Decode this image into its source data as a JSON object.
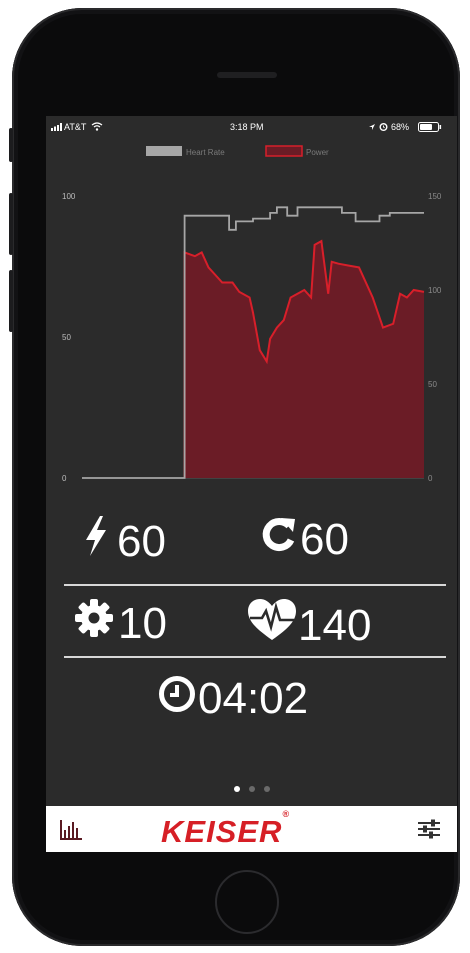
{
  "status_bar": {
    "carrier": "AT&T",
    "time": "3:18 PM",
    "battery": "68%",
    "icons": [
      "signal-icon",
      "wifi-icon",
      "location-icon",
      "alarm-icon",
      "battery-icon"
    ]
  },
  "chart_data": {
    "type": "line",
    "legend": [
      "Heart Rate",
      "Power"
    ],
    "legend_position": "top-center",
    "series_colors": {
      "Heart Rate": "#a6a6a6",
      "Power": "#d81f2a",
      "Power_fill": "#6b1c26"
    },
    "left_axis": {
      "ticks": [
        0,
        50,
        100
      ],
      "range": [
        0,
        100
      ]
    },
    "right_axis": {
      "ticks": [
        0,
        50,
        100,
        150
      ],
      "range": [
        0,
        150
      ]
    },
    "x_range": [
      0,
      100
    ],
    "series": [
      {
        "name": "Heart Rate",
        "axis": "left",
        "points": [
          [
            0,
            0
          ],
          [
            30,
            0
          ],
          [
            30,
            93
          ],
          [
            43,
            93
          ],
          [
            43,
            88
          ],
          [
            45,
            88
          ],
          [
            45,
            91
          ],
          [
            50,
            91
          ],
          [
            50,
            92
          ],
          [
            55,
            92
          ],
          [
            55,
            94
          ],
          [
            57,
            94
          ],
          [
            57,
            96
          ],
          [
            60,
            96
          ],
          [
            60,
            93
          ],
          [
            63,
            93
          ],
          [
            63,
            96
          ],
          [
            76,
            96
          ],
          [
            76,
            94
          ],
          [
            80,
            94
          ],
          [
            80,
            91
          ],
          [
            87,
            91
          ],
          [
            87,
            93
          ],
          [
            90,
            93
          ],
          [
            90,
            94
          ],
          [
            100,
            94
          ]
        ]
      },
      {
        "name": "Power",
        "axis": "right",
        "points": [
          [
            30,
            0
          ],
          [
            30,
            120
          ],
          [
            33,
            118
          ],
          [
            35,
            120
          ],
          [
            37,
            112
          ],
          [
            39,
            108
          ],
          [
            41,
            104
          ],
          [
            44,
            104
          ],
          [
            46,
            99
          ],
          [
            49,
            96
          ],
          [
            50,
            88
          ],
          [
            52,
            68
          ],
          [
            54,
            62
          ],
          [
            55,
            74
          ],
          [
            57,
            80
          ],
          [
            59,
            84
          ],
          [
            61,
            96
          ],
          [
            63,
            98
          ],
          [
            65,
            100
          ],
          [
            67,
            96
          ],
          [
            68,
            124
          ],
          [
            70,
            126
          ],
          [
            72,
            98
          ],
          [
            73,
            115
          ],
          [
            75,
            114
          ],
          [
            78,
            113
          ],
          [
            81,
            112
          ],
          [
            85,
            96
          ],
          [
            88,
            80
          ],
          [
            91,
            82
          ],
          [
            93,
            98
          ],
          [
            95,
            96
          ],
          [
            97,
            100
          ],
          [
            100,
            99
          ]
        ]
      }
    ]
  },
  "metrics": {
    "power": {
      "icon": "lightning-icon",
      "value": "60"
    },
    "cadence": {
      "icon": "refresh-icon",
      "value": "60"
    },
    "gear": {
      "icon": "gear-icon",
      "value": "10"
    },
    "heart_rate": {
      "icon": "heart-rate-icon",
      "value": "140"
    },
    "duration": {
      "icon": "clock-icon",
      "value": "04:02"
    }
  },
  "pager": {
    "count": 3,
    "active": 1
  },
  "tab_bar": {
    "left_icon": "bar-chart-icon",
    "brand": "KEISER",
    "brand_color": "#d61f26",
    "right_icon": "sliders-icon"
  }
}
